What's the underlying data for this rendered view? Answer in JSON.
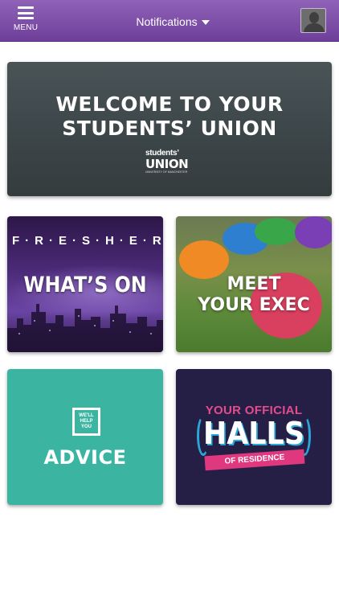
{
  "header": {
    "menu_label": "MENU",
    "notifications_label": "Notifications"
  },
  "cards": {
    "welcome": {
      "line1": "WELCOME TO YOUR",
      "line2": "STUDENTS’ UNION",
      "logo_small": "students’",
      "logo_big": "UNION",
      "logo_tiny": "UNIVERSITY OF MANCHESTER"
    },
    "freshers": {
      "top": "F·R·E·S·H·E·R·S",
      "main": "WHAT’S ON"
    },
    "exec": {
      "line1": "MEET",
      "line2": "YOUR EXEC"
    },
    "advice": {
      "box_line1": "WE'LL",
      "box_line2": "HELP",
      "box_line3": "YOU",
      "label": "ADVICE"
    },
    "halls": {
      "top": "YOUR OFFICIAL",
      "main": "HALLS",
      "ribbon": "OF RESIDENCE"
    }
  },
  "colors": {
    "header_top": "#8f62b8",
    "header_bottom": "#6e3f99",
    "advice_bg": "#3bb5a2",
    "halls_bg": "#261f45",
    "halls_pink": "#e54b8f",
    "halls_blue": "#2aa7d8"
  },
  "icons": [
    "hamburger-menu-icon",
    "caret-down-icon",
    "user-avatar-icon"
  ]
}
